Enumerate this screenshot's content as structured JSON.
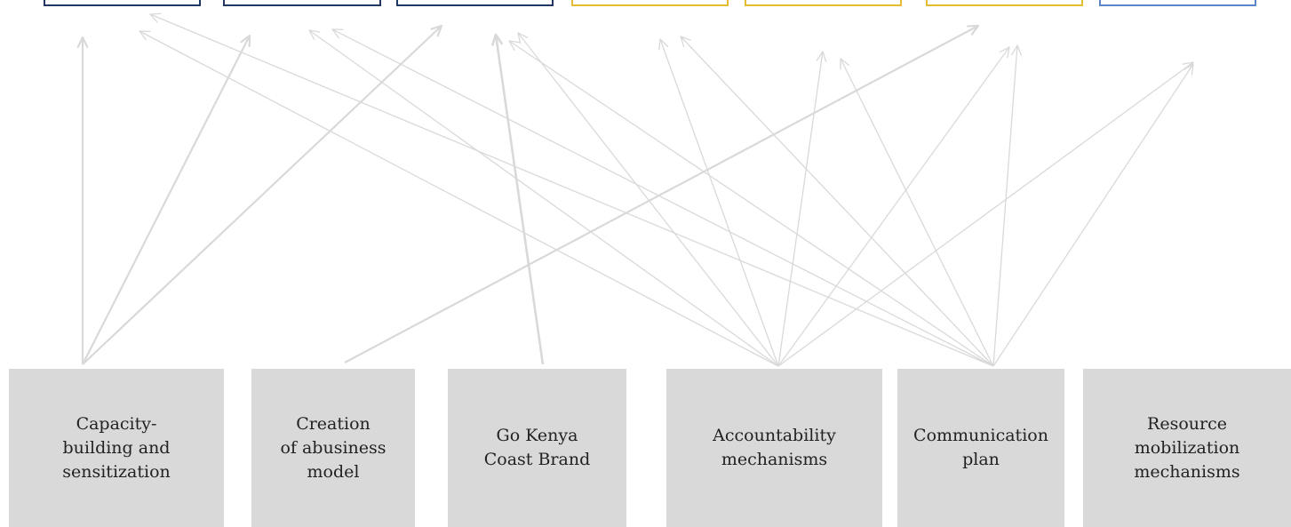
{
  "colors": {
    "top_navy": "#1f3864",
    "top_gold": "#e5bd32",
    "top_blue": "#5b85c6",
    "node_fill": "#d9d9d9",
    "arrow": "#d9d9d9"
  },
  "top_boxes": [
    {
      "id": "b1",
      "color": "navy"
    },
    {
      "id": "b2",
      "color": "navy"
    },
    {
      "id": "b3",
      "color": "navy"
    },
    {
      "id": "b4",
      "color": "gold"
    },
    {
      "id": "b5",
      "color": "gold"
    },
    {
      "id": "b6",
      "color": "gold"
    },
    {
      "id": "b7",
      "color": "blue"
    }
  ],
  "nodes": [
    {
      "id": "n1",
      "label": "Capacity-\nbuilding and\nsensitization"
    },
    {
      "id": "n2",
      "label": "Creation\nof abusiness\nmodel"
    },
    {
      "id": "n3",
      "label": "Go Kenya\nCoast Brand"
    },
    {
      "id": "n4",
      "label": "Accountability\nmechanisms"
    },
    {
      "id": "n5",
      "label": "Communication\nplan"
    },
    {
      "id": "n6",
      "label": "Resource\nmobilization\nmechanisms"
    }
  ]
}
